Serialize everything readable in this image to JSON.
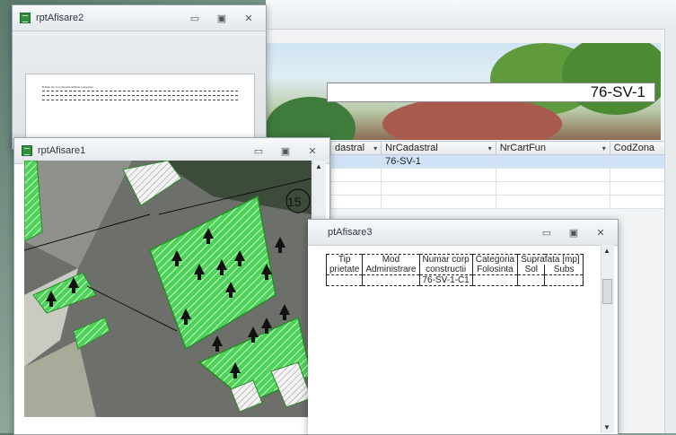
{
  "back_form": {
    "code_value": "76-SV-1",
    "columns": [
      "dastral",
      "NrCadastral",
      "NrCartFun",
      "CodZona"
    ],
    "rows": [
      [
        "",
        "76-SV-1",
        "",
        ""
      ],
      [
        "",
        "",
        "",
        ""
      ],
      [
        "",
        "",
        "",
        ""
      ],
      [
        "",
        "",
        "",
        ""
      ]
    ]
  },
  "win2": {
    "title": "rptAfisare2",
    "preview_line": "B.Date sle si constructii abilitate respective"
  },
  "win1": {
    "title": "rptAfisare1",
    "map_label": "15"
  },
  "win3": {
    "title": "ptAfisare3",
    "header1": [
      "Tip",
      "Mod",
      "Numar corp",
      "Categoria",
      "Suprafata  [mp]",
      ""
    ],
    "header2": [
      "prietate",
      "Administrare",
      "constructii",
      "Folosinta",
      "Sol",
      "Subs"
    ],
    "row": [
      "",
      "",
      "76-SV-1-C1",
      "",
      "",
      ""
    ]
  },
  "controls": {
    "minimize": "▭",
    "maximize": "▣",
    "close": "✕"
  }
}
